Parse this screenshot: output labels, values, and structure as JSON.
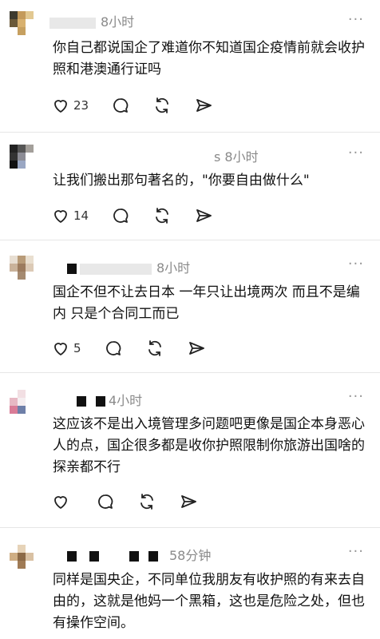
{
  "comments": [
    {
      "time": "8小时",
      "text": "你自己都说国企了难道你不知道国企疫情前就会收护照和港澳通行证吗",
      "likes": "23"
    },
    {
      "time": "s 8小时",
      "text": "让我们搬出那句著名的，\"你要自由做什么\"",
      "likes": "14"
    },
    {
      "time": "8小时",
      "text": "国企不但不让去日本 一年只让出境两次 而且不是编内 只是个合同工而已",
      "likes": "5"
    },
    {
      "time": "4小时",
      "text": "这应该不是出入境管理多问题吧更像是国企本身恶心人的点，国企很多都是收你护照限制你旅游出国啥的探亲都不行",
      "likes": ""
    },
    {
      "time": "58分钟",
      "text": "同样是国央企，不同单位我朋友有收护照的有来去自由的，这就是他妈一个黑箱，这也是危险之处，但也有操作空间。",
      "likes": ""
    }
  ],
  "more_label": "···",
  "icons": {
    "like": "heart-icon",
    "comment": "comment-icon",
    "repost": "repost-icon",
    "share": "share-icon",
    "more": "more-icon"
  }
}
